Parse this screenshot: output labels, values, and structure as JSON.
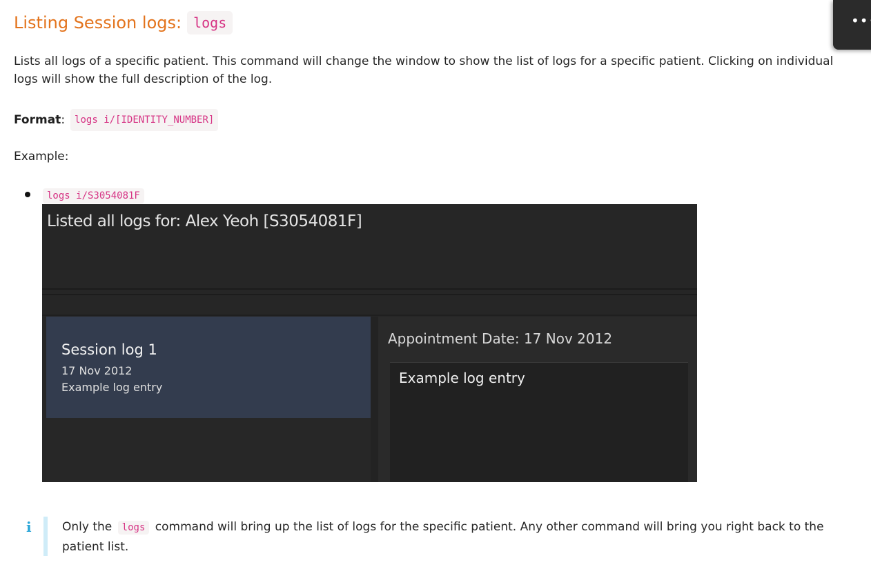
{
  "doc": {
    "heading": "Listing Session logs:",
    "heading_code": "logs",
    "description": "Lists all logs of a specific patient. This command will change the window to show the list of logs for a specific patient. Clicking on individual logs will show the full description of the log.",
    "format_label": "Format",
    "format_colon": ":",
    "format_code": "logs i/[IDENTITY_NUMBER]",
    "example_label": "Example:",
    "example_item_code": "logs i/S3054081F"
  },
  "app": {
    "result_text": "Listed all logs for: Alex Yeoh [S3054081F]",
    "log_list": [
      {
        "title": "Session log 1",
        "date": "17 Nov 2012",
        "description": "Example log entry"
      }
    ],
    "detail": {
      "appointment_date": "Appointment Date: 17 Nov 2012",
      "description": "Example log entry"
    }
  },
  "callout": {
    "icon": "info-icon",
    "icon_glyph": "i",
    "text_before": "Only the",
    "code": "logs",
    "text_after": "command will bring up the list of logs for the specific patient. Any other command will bring you right back to the patient list."
  },
  "overlay": {
    "menu_icon": "more-dots-icon",
    "menu_glyph": "•••"
  },
  "colors": {
    "heading": "#e3731c",
    "code_text": "#d63384",
    "code_bg": "#f6f3f3",
    "app_bg": "#262626",
    "selected_card": "#333c4e",
    "callout_bar": "#cfecf8",
    "info_icon": "#2aa6d8"
  }
}
